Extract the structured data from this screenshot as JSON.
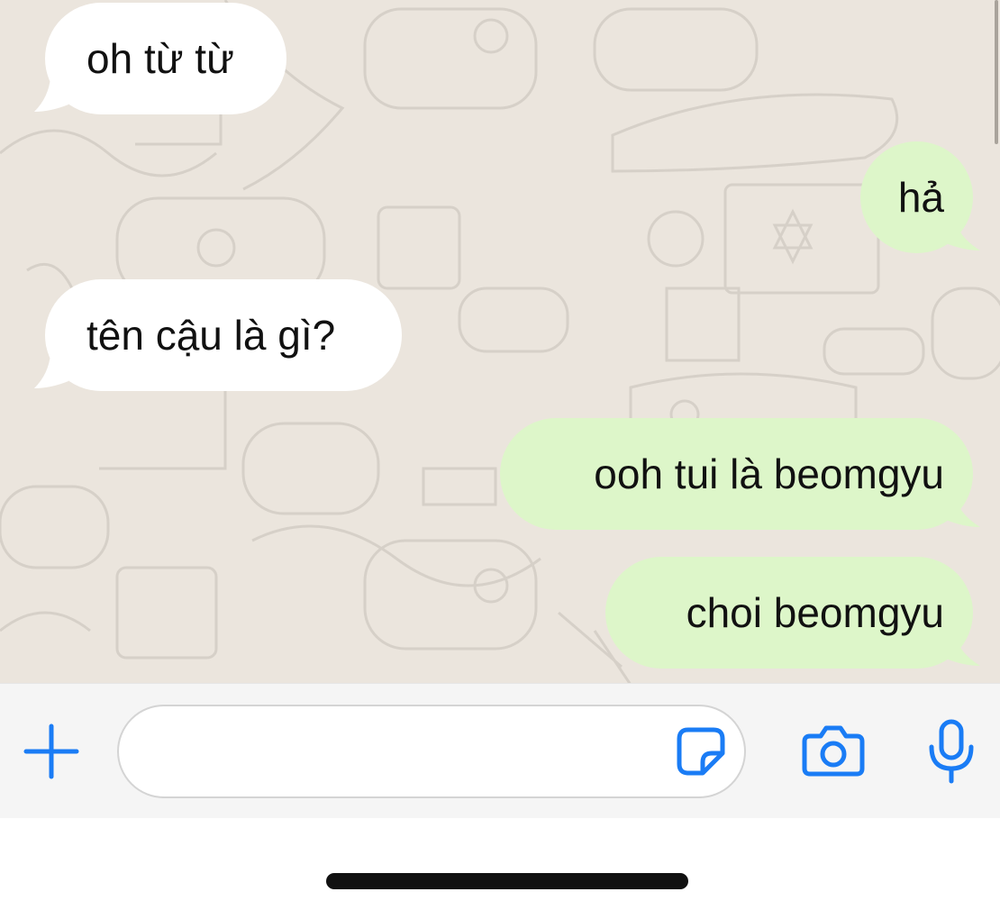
{
  "messages": [
    {
      "direction": "incoming",
      "text": "oh từ từ"
    },
    {
      "direction": "outgoing",
      "text": "hả"
    },
    {
      "direction": "incoming",
      "text": "tên cậu là gì?"
    },
    {
      "direction": "outgoing",
      "text": "ooh tui là beomgyu"
    },
    {
      "direction": "outgoing",
      "text": "choi beomgyu"
    }
  ],
  "composer": {
    "input_value": "",
    "icons": [
      "plus-icon",
      "sticker-icon",
      "camera-icon",
      "microphone-icon"
    ]
  },
  "colors": {
    "chat_background": "#ebe5dd",
    "incoming_bubble": "#ffffff",
    "outgoing_bubble": "#ddf6c9",
    "accent": "#1a7cf5"
  }
}
